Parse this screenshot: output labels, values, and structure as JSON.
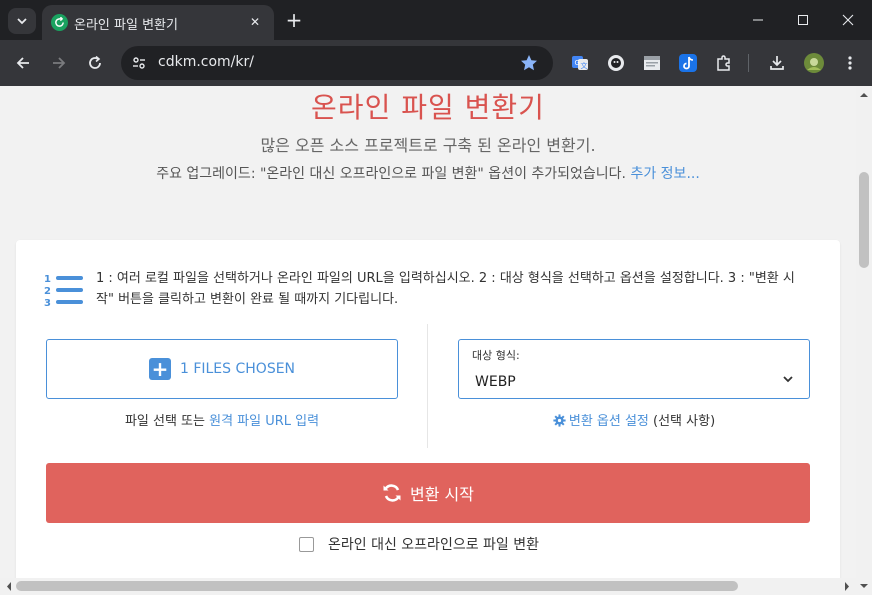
{
  "browser": {
    "tab_title": "온라인 파일 변환기",
    "url": "cdkm.com/kr/"
  },
  "hero": {
    "title": "온라인 파일 변환기",
    "subtitle": "많은 오픈 소스 프로젝트로 구축 된 온라인 변환기.",
    "note": "주요 업그레이드: \"온라인 대신 오프라인으로 파일 변환\" 옵션이 추가되었습니다.",
    "more_link": "추가 정보..."
  },
  "steps": {
    "text": "1 : 여러 로컬 파일을 선택하거나 온라인 파일의 URL을 입력하십시오. 2 : 대상 형식을 선택하고 옵션을 설정합니다. 3 : \"변환 시작\" 버튼을 클릭하고 변환이 완료 될 때까지 기다립니다."
  },
  "file_picker": {
    "button_label": "1 FILES CHOSEN",
    "help_prefix": "파일 선택 또는 ",
    "help_link": "원격 파일 URL 입력"
  },
  "target": {
    "label": "대상 형식:",
    "value": "WEBP",
    "options_link": "변환 옵션 설정",
    "options_suffix": " (선택 사항)"
  },
  "convert": {
    "button_label": "변환 시작",
    "offline_label": "온라인 대신 오프라인으로 파일 변환"
  },
  "colors": {
    "accent": "#4a90d9",
    "danger": "#e0635d",
    "title": "#d9534f"
  }
}
